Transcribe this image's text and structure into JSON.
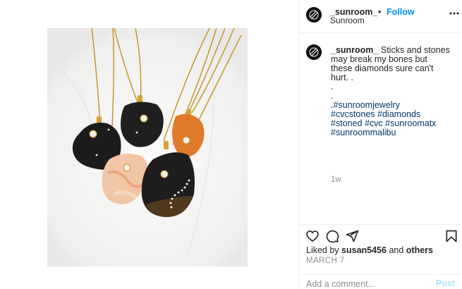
{
  "post": {
    "username": "_sunroom_",
    "separator": "•",
    "follow_label": "Follow",
    "location": "Sunroom",
    "more_icon": "more-options-icon"
  },
  "caption": {
    "username": "_sunroom_",
    "text_line1": " Sticks and stones",
    "text_line2": "may break my bones but",
    "text_line3": "these diamonds sure can't",
    "text_line4": "hurt. .",
    "dot1": ".",
    "dot2": ".",
    "tag_prefix": ".",
    "hashtags": [
      "#sunroomjewelry",
      "#cvcstones",
      "#diamonds",
      "#stoned",
      "#cvc",
      "#sunroomatx",
      "#sunroommalibu"
    ],
    "time_ago": "1w"
  },
  "actions": {
    "icons": [
      "heart-icon",
      "comment-icon",
      "share-icon",
      "bookmark-icon"
    ],
    "liked_by_prefix": "Liked by ",
    "liked_by_user": "susan5456",
    "liked_by_and": " and ",
    "liked_by_others": "others",
    "date": "MARCH 7"
  },
  "comment": {
    "placeholder": "Add a comment...",
    "post_label": "Post"
  },
  "colors": {
    "link_blue": "#0095f6",
    "hashtag_blue": "#00376b",
    "muted_gray": "#8e8e8e",
    "post_disabled": "#b2dffc"
  }
}
